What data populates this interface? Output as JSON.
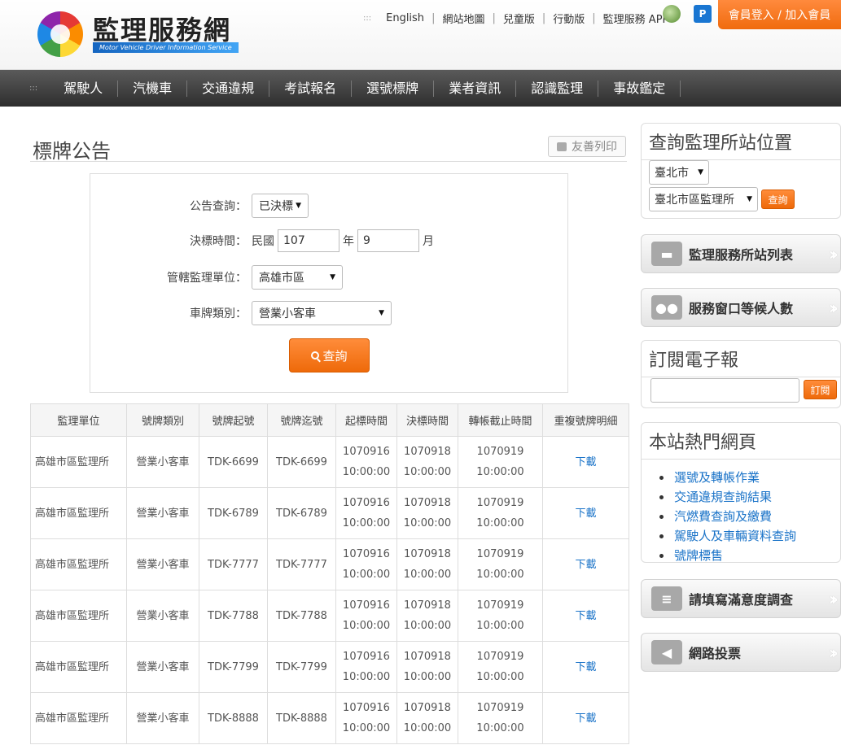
{
  "header": {
    "logo_title": "監理服務網",
    "logo_subtitle": "Motor Vehicle Driver Information Service",
    "top_links": [
      "English",
      "網站地圖",
      "兒童版",
      "行動版",
      "監理服務 APP"
    ],
    "top_dots": ":::",
    "member_button": "會員登入 / 加入會員",
    "icon_blue_label": "P"
  },
  "nav": {
    "dots": ":::",
    "items": [
      "駕駛人",
      "汽機車",
      "交通違規",
      "考試報名",
      "選號標牌",
      "業者資訊",
      "認識監理",
      "事故鑑定"
    ]
  },
  "main": {
    "page_title": "標牌公告",
    "print_label": "友善列印",
    "form": {
      "announce_label": "公告查詢：",
      "announce_value": "已決標",
      "date_label": "決標時間：",
      "era_prefix": "民國",
      "year_value": "107",
      "year_unit": "年",
      "month_value": "9",
      "month_unit": "月",
      "office_label": "管轄監理單位：",
      "office_value": "高雄市區",
      "plate_type_label": "車牌類別：",
      "plate_type_value": "營業小客車",
      "query_button": "查詢"
    },
    "table": {
      "headers": [
        "監理單位",
        "號牌類別",
        "號牌起號",
        "號牌迄號",
        "起標時間",
        "決標時間",
        "轉帳截止時間",
        "重複號牌明細"
      ],
      "rows": [
        {
          "unit": "高雄市區監理所",
          "type": "營業小客車",
          "start": "TDK-6699",
          "end": "TDK-6699",
          "bid_date": "1070916",
          "bid_time": "10:00:00",
          "award_date": "1070918",
          "award_time": "10:00:00",
          "transfer_date": "1070919",
          "transfer_time": "10:00:00",
          "detail": "下載"
        },
        {
          "unit": "高雄市區監理所",
          "type": "營業小客車",
          "start": "TDK-6789",
          "end": "TDK-6789",
          "bid_date": "1070916",
          "bid_time": "10:00:00",
          "award_date": "1070918",
          "award_time": "10:00:00",
          "transfer_date": "1070919",
          "transfer_time": "10:00:00",
          "detail": "下載"
        },
        {
          "unit": "高雄市區監理所",
          "type": "營業小客車",
          "start": "TDK-7777",
          "end": "TDK-7777",
          "bid_date": "1070916",
          "bid_time": "10:00:00",
          "award_date": "1070918",
          "award_time": "10:00:00",
          "transfer_date": "1070919",
          "transfer_time": "10:00:00",
          "detail": "下載"
        },
        {
          "unit": "高雄市區監理所",
          "type": "營業小客車",
          "start": "TDK-7788",
          "end": "TDK-7788",
          "bid_date": "1070916",
          "bid_time": "10:00:00",
          "award_date": "1070918",
          "award_time": "10:00:00",
          "transfer_date": "1070919",
          "transfer_time": "10:00:00",
          "detail": "下載"
        },
        {
          "unit": "高雄市區監理所",
          "type": "營業小客車",
          "start": "TDK-7799",
          "end": "TDK-7799",
          "bid_date": "1070916",
          "bid_time": "10:00:00",
          "award_date": "1070918",
          "award_time": "10:00:00",
          "transfer_date": "1070919",
          "transfer_time": "10:00:00",
          "detail": "下載"
        },
        {
          "unit": "高雄市區監理所",
          "type": "營業小客車",
          "start": "TDK-8888",
          "end": "TDK-8888",
          "bid_date": "1070916",
          "bid_time": "10:00:00",
          "award_date": "1070918",
          "award_time": "10:00:00",
          "transfer_date": "1070919",
          "transfer_time": "10:00:00",
          "detail": "下載"
        }
      ]
    }
  },
  "sidebar": {
    "location_title": "查詢監理所站位置",
    "city_value": "臺北市",
    "station_value": "臺北市區監理所",
    "location_query": "查詢",
    "station_list": "監理服務所站列表",
    "waiting": "服務窗口等候人數",
    "newsletter_title": "訂閱電子報",
    "newsletter_button": "訂閱",
    "hot_title": "本站熱門網頁",
    "hot_links": [
      "選號及轉帳作業",
      "交通違規查詢結果",
      "汽燃費查詢及繳費",
      "駕駛人及車輛資料查詢",
      "號牌標售"
    ],
    "survey": "請填寫滿意度調查",
    "vote": "網路投票"
  },
  "colors": {
    "accent": "#f07a1f",
    "nav_bg": "#3a3a3a",
    "link": "#1a73c8"
  }
}
